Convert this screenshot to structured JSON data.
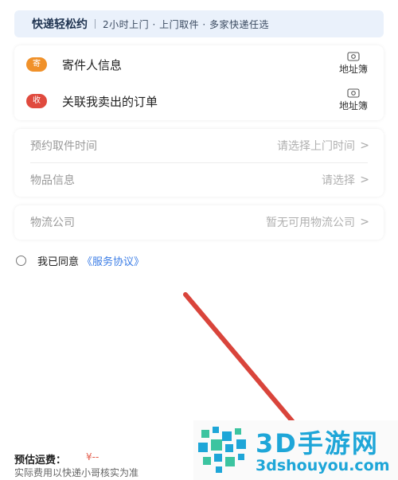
{
  "banner": {
    "title": "快递轻松约",
    "subtitle": "2小时上门 · 上门取件 · 多家快递任选"
  },
  "contacts": {
    "sender": {
      "badge": "寄",
      "label": "寄件人信息",
      "book": "地址簿"
    },
    "order": {
      "badge": "收",
      "label": "关联我卖出的订单",
      "book": "地址簿"
    }
  },
  "fields": {
    "pickup_time": {
      "label": "预约取件时间",
      "value": "请选择上门时间"
    },
    "item_info": {
      "label": "物品信息",
      "value": "请选择"
    },
    "logistics": {
      "label": "物流公司",
      "value": "暂无可用物流公司"
    },
    "chevron": ">"
  },
  "agreement": {
    "text": "我已同意",
    "link": "《服务协议》"
  },
  "footer": {
    "fee_label": "预估运费：",
    "fee_value": "¥--",
    "fee_note": "实际费用以快递小哥核实为准"
  },
  "watermark": {
    "title": "3D手游网",
    "url": "3dshouyou.com"
  },
  "colors": {
    "accent_blue": "#3b7de6",
    "badge_orange": "#f0912a",
    "badge_red": "#e04a3e",
    "annotation_arrow": "#d9443b",
    "watermark": "#1ea6d8"
  }
}
